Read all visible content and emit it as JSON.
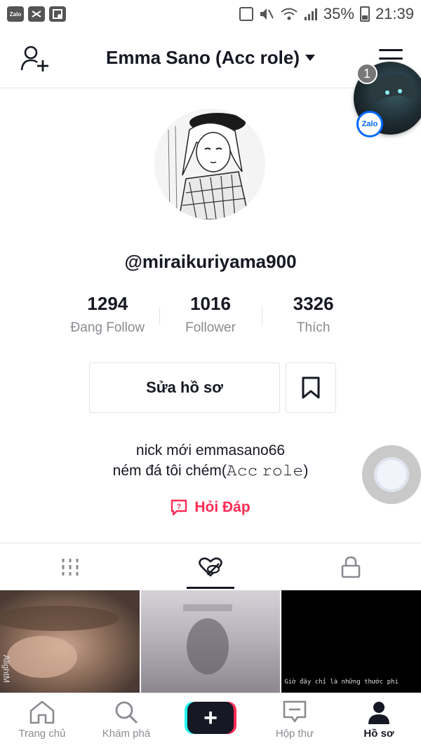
{
  "status_bar": {
    "left_apps": [
      "Zalo",
      "CapCut",
      "Gallery"
    ],
    "battery": "35%",
    "time": "21:39"
  },
  "header": {
    "title": "Emma Sano (Acc role)"
  },
  "overlay": {
    "bubble_count": "1",
    "bubble_app": "Zalo"
  },
  "profile": {
    "username": "@miraikuriyama900",
    "stats": [
      {
        "value": "1294",
        "label": "Đang Follow"
      },
      {
        "value": "1016",
        "label": "Follower"
      },
      {
        "value": "3326",
        "label": "Thích"
      }
    ],
    "edit_label": "Sửa hồ sơ",
    "bio_line1": "nick mới emmasano66",
    "bio_line2": "ném đá tôi chém(𝙰𝚌𝚌 𝚛𝚘𝚕𝚎)",
    "qa_label": "Hỏi Đáp"
  },
  "grid": {
    "thumb1_side": "AlightM",
    "thumb3_caption": "Giờ đây chỉ là những thước phi"
  },
  "bottom_nav": {
    "home": "Trang chủ",
    "discover": "Khám phá",
    "inbox": "Hộp thư",
    "profile": "Hồ sơ"
  }
}
